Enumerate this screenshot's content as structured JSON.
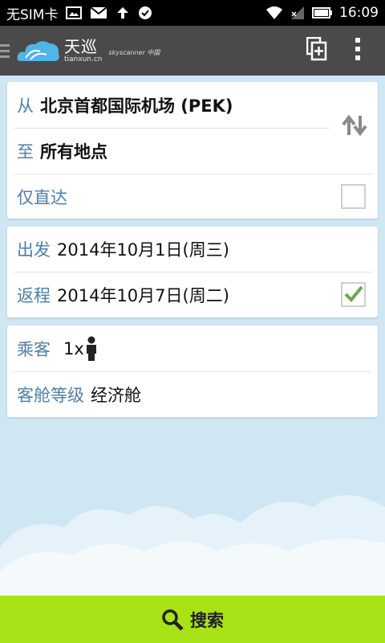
{
  "status_bar": {
    "carrier": "无SIM卡",
    "time": "16:09"
  },
  "app_bar": {
    "logo_main": "天巡",
    "logo_sub": "tianxun.cn",
    "logo_brand": "skyscanner 中国"
  },
  "route": {
    "from_label": "从",
    "from_value": "北京首都国际机场 (PEK)",
    "to_label": "至",
    "to_value": "所有地点",
    "direct_label": "仅直达",
    "direct_checked": false
  },
  "dates": {
    "depart_label": "出发",
    "depart_value": "2014年10月1日(周三)",
    "return_label": "返程",
    "return_value": "2014年10月7日(周二)",
    "return_checked": true
  },
  "passengers": {
    "label": "乘客",
    "count": "1x",
    "class_label": "客舱等级",
    "class_value": "经济舱"
  },
  "search": {
    "label": "搜索"
  },
  "colors": {
    "background": "#cfe6f3",
    "label_blue": "#4f7fa8",
    "search_green": "#a8e317",
    "check_green": "#6aa84f",
    "app_bar": "#4a4a4a"
  }
}
